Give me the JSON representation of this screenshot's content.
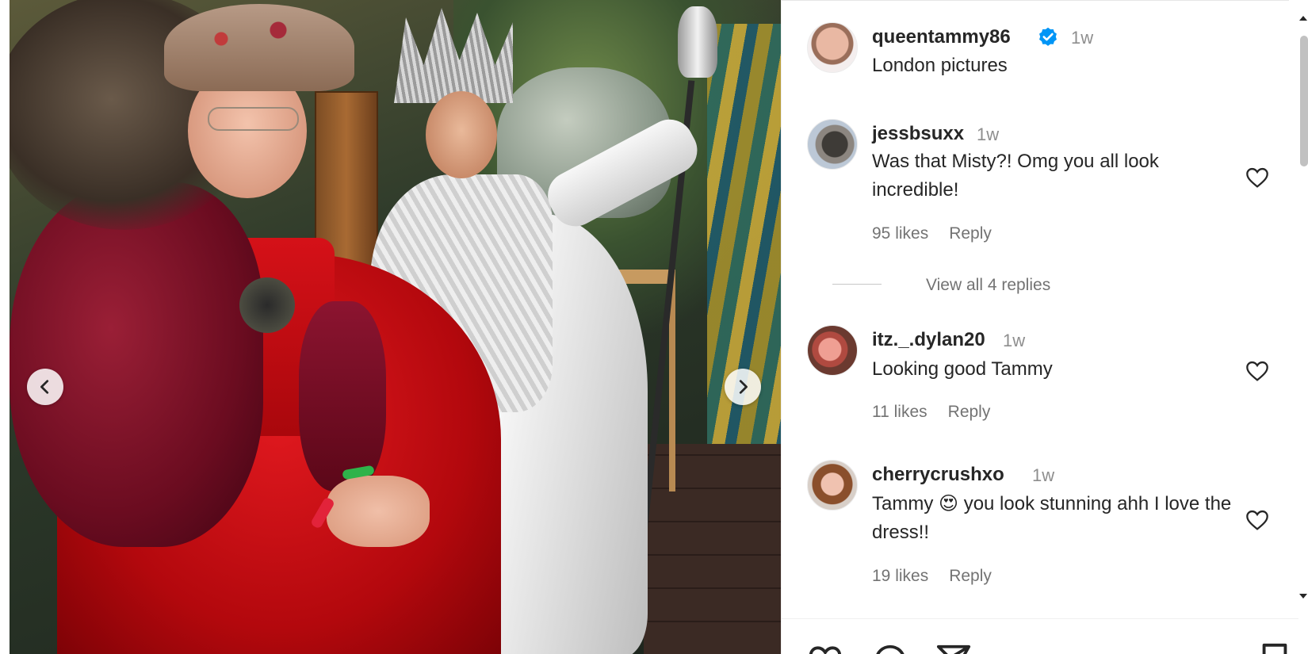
{
  "post": {
    "author": "queentammy86",
    "time": "1w",
    "caption": "London pictures",
    "verified": true,
    "media_alt_icon": "photo"
  },
  "comments": [
    {
      "username": "jessbsuxx",
      "time": "1w",
      "text": "Was that Misty?! Omg you all look incredible!",
      "likes": "95 likes",
      "reply": "Reply",
      "view_replies": "View all 4 replies"
    },
    {
      "username": "itz._.dylan20",
      "time": "1w",
      "text": "Looking good Tammy",
      "likes": "11 likes",
      "reply": "Reply"
    },
    {
      "username": "cherrycrushxo",
      "time": "1w",
      "text": "Tammy 😍 you look stunning ahh I love the dress!!",
      "likes": "19 likes",
      "reply": "Reply"
    }
  ],
  "icons": {
    "prev": "chevron-left-icon",
    "next": "chevron-right-icon",
    "like": "heart-icon",
    "comment": "comment-icon",
    "share": "share-icon",
    "save": "bookmark-icon",
    "verified": "verified-badge-icon"
  },
  "colors": {
    "verified_blue": "#0095f6",
    "text": "#262626",
    "muted": "#8e8e8e"
  }
}
